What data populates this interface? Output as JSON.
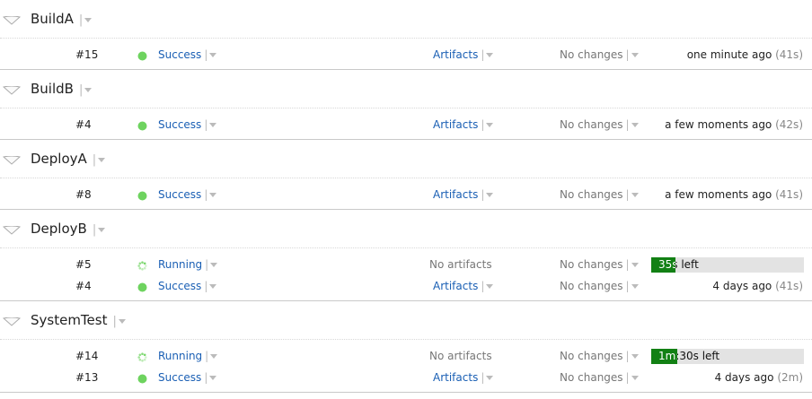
{
  "colors": {
    "link": "#1a5fb4",
    "success": "#6ed35f",
    "running": "#6ed35f",
    "progress": "#128014"
  },
  "groups": [
    {
      "name": "BuildA",
      "builds": [
        {
          "number": "#15",
          "status": "Success",
          "artifacts": "Artifacts",
          "changes": "No changes",
          "time": "one minute ago",
          "duration": "(41s)"
        }
      ]
    },
    {
      "name": "BuildB",
      "builds": [
        {
          "number": "#4",
          "status": "Success",
          "artifacts": "Artifacts",
          "changes": "No changes",
          "time": "a few moments ago",
          "duration": "(42s)"
        }
      ]
    },
    {
      "name": "DeployA",
      "builds": [
        {
          "number": "#8",
          "status": "Success",
          "artifacts": "Artifacts",
          "changes": "No changes",
          "time": "a few moments ago",
          "duration": "(41s)"
        }
      ]
    },
    {
      "name": "DeployB",
      "builds": [
        {
          "number": "#5",
          "status": "Running",
          "artifacts": "No artifacts",
          "changes": "No changes",
          "progress_text": "35s left",
          "progress_fraction": 0.16
        },
        {
          "number": "#4",
          "status": "Success",
          "artifacts": "Artifacts",
          "changes": "No changes",
          "time": "4 days ago",
          "duration": "(41s)"
        }
      ]
    },
    {
      "name": "SystemTest",
      "builds": [
        {
          "number": "#14",
          "status": "Running",
          "artifacts": "No artifacts",
          "changes": "No changes",
          "progress_text": "1m:30s left",
          "progress_fraction": 0.17
        },
        {
          "number": "#13",
          "status": "Success",
          "artifacts": "Artifacts",
          "changes": "No changes",
          "time": "4 days ago",
          "duration": "(2m)"
        }
      ]
    }
  ]
}
